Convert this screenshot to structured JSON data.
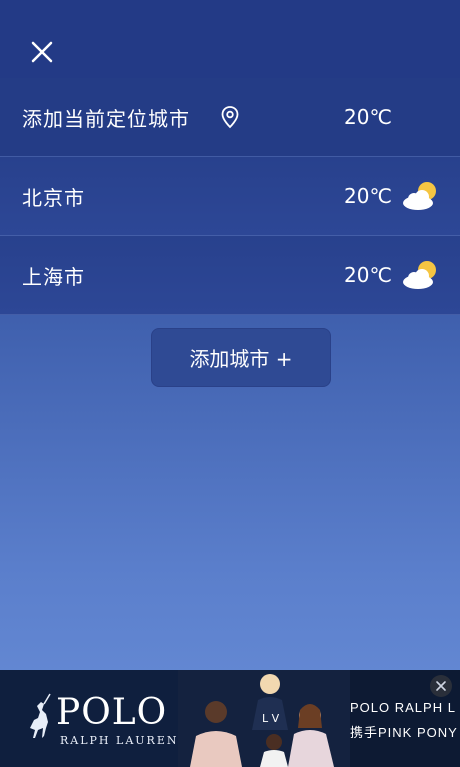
{
  "header": {
    "close_icon": "close-icon"
  },
  "locate_row": {
    "label": "添加当前定位城市",
    "icon": "location-pin-icon",
    "temp": "20℃"
  },
  "cities": [
    {
      "name": "北京市",
      "temp": "20℃",
      "weather_icon": "partly-cloudy-icon"
    },
    {
      "name": "上海市",
      "temp": "20℃",
      "weather_icon": "partly-cloudy-icon"
    }
  ],
  "add_button": {
    "label": "添加城市 +"
  },
  "ad": {
    "brand_logo": "POLO",
    "brand_sub": "RALPH LAUREN",
    "copy_line1": "POLO RALPH L",
    "copy_line2": "携手PINK PONY",
    "close_icon": "close-icon"
  },
  "colors": {
    "bg_top": "#233a86",
    "bg_bottom": "#6a8fd8",
    "sun": "#f5c542"
  }
}
